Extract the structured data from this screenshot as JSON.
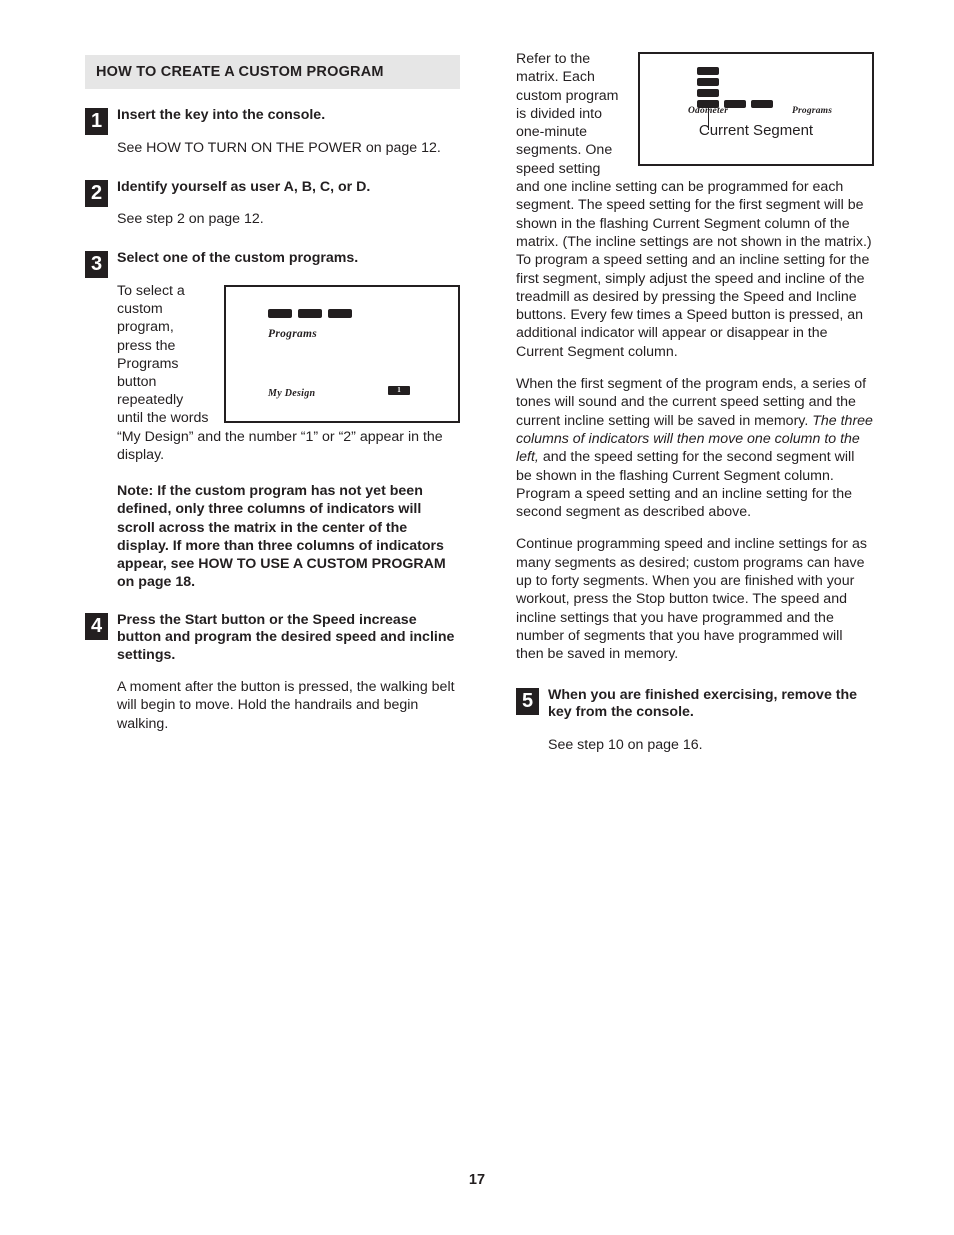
{
  "document": {
    "page_number": "17"
  },
  "left_column": {
    "section_header": "HOW TO CREATE A CUSTOM PROGRAM",
    "steps": [
      {
        "number": "1",
        "title": "Insert the key into the console.",
        "body": "See HOW TO TURN ON THE POWER on page 12."
      },
      {
        "number": "2",
        "title": "Identify yourself as user A, B, C, or D.",
        "body": "See step 2 on page 12."
      },
      {
        "number": "3",
        "title": "Select one of the custom programs.",
        "body": "To select a custom program, press the Programs button repeatedly until the words “My Design” and the number “1” or “2” appear in the display."
      },
      {
        "number": "4",
        "title": "Press the Start button or the Speed increase button and program the desired speed and incline settings.",
        "body": "A moment after the button is pressed, the walking belt will begin to move. Hold the handrails and begin walking."
      }
    ],
    "note": "Note: If the custom program has not yet been defined, only three columns of indicators will scroll across the matrix in the center of the display. If more than three columns of indicators appear, see HOW TO USE A CUSTOM PROGRAM on page 18.",
    "figure_console": {
      "label_programs": "Programs",
      "label_my_design": "My Design",
      "badge_value": "1",
      "indicator_bars": 3
    }
  },
  "right_column": {
    "figure_matrix": {
      "label_odometer": "Odometer",
      "label_programs": "Programs",
      "caption": "Current Segment",
      "column_bars": 4,
      "row_extra_bars": 2
    },
    "paragraphs": [
      "Refer to the matrix. Each custom program is divided into one-minute segments. One speed setting and one incline setting can be programmed for each segment. The speed setting for the first segment will be shown in the flashing Current Segment column of the matrix. (The incline settings are not shown in the matrix.) To program a speed setting and an incline setting for the first segment, simply adjust the speed and incline of the treadmill as desired by pressing the Speed and Incline buttons. Every few times a Speed button is pressed, an additional indicator will appear or disappear in the Current Segment column.",
      "Continue programming speed and incline settings for as many segments as desired; custom programs can have up to forty segments. When you are finished with your workout, press the Stop button twice. The speed and incline settings that you have programmed and the number of segments that you have programmed will then be saved in memory."
    ],
    "paragraph_emphasis": {
      "lead": "When the first segment of the program ends, a series of tones will sound and the current speed setting and the current incline setting will be saved in memory. ",
      "italic": "The three columns of indicators will then move one column to the left,",
      "tail": " and the speed setting for the second segment will be shown in the flashing Current Segment column. Program a speed setting and an incline setting for the second segment as described above."
    },
    "step": {
      "number": "5",
      "title": "When you are finished exercising, remove the key from the console.",
      "body": "See step 10 on page 16."
    }
  }
}
